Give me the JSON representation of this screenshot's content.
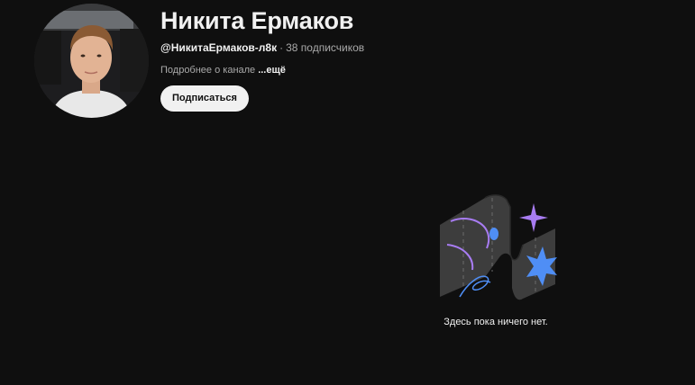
{
  "channel": {
    "name": "Никита Ермаков",
    "handle": "@НикитаЕрмаков-л8к",
    "separator": "·",
    "subscribers": "38 подписчиков",
    "about": "Подробнее о канале",
    "more_link": "...ещё",
    "subscribe_label": "Подписаться",
    "avatar_icon": "profile-photo"
  },
  "empty_state": {
    "message": "Здесь пока ничего нет.",
    "illustration_icon": "empty-content-illustration",
    "colors": {
      "purple": "#a87cf2",
      "blue": "#4f8ef5",
      "panel": "#3d3d3d"
    }
  }
}
